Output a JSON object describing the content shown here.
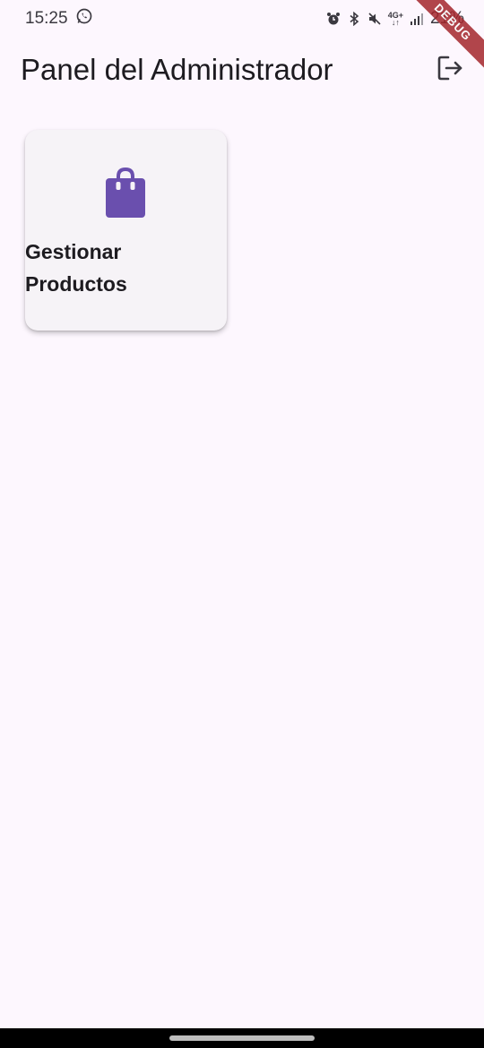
{
  "status_bar": {
    "time": "15:25",
    "left_icons": [
      "whatsapp-icon"
    ],
    "right_icons": [
      "alarm-icon",
      "bluetooth-icon",
      "mute-icon",
      "network-4g-icon",
      "signal-icon"
    ],
    "network_label": "4G+",
    "battery": "21%"
  },
  "debug_banner": {
    "label": "DEBUG"
  },
  "app_bar": {
    "title": "Panel del Administrador",
    "actions": [
      {
        "icon": "logout-icon"
      }
    ]
  },
  "dashboard": {
    "cards": [
      {
        "icon": "shopping-bag-icon",
        "label": "Gestionar Productos"
      }
    ]
  },
  "colors": {
    "background": "#fdf7fe",
    "card": "#f6f3f7",
    "accent": "#6a4fae",
    "debug": "#a4262c"
  }
}
